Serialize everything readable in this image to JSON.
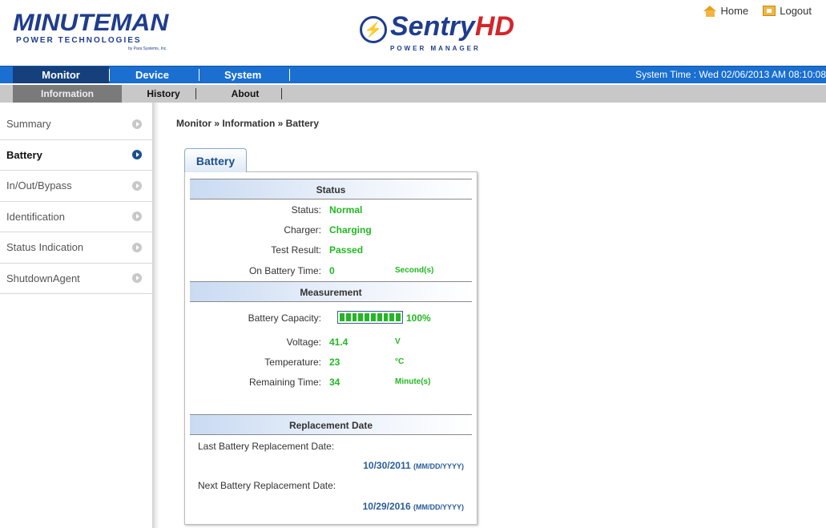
{
  "brand": {
    "name": "MINUTEMAN",
    "subtitle": "POWER TECHNOLOGIES",
    "fine": "by Para Systems, Inc.",
    "product": "Sentry",
    "product_suffix": "HD",
    "product_sub": "POWER MANAGER"
  },
  "toplinks": {
    "home": "Home",
    "logout": "Logout"
  },
  "mainnav": {
    "tabs": [
      "Monitor",
      "Device",
      "System"
    ],
    "system_time": "System Time : Wed 02/06/2013 AM 08:10:08"
  },
  "subnav": {
    "tabs": [
      "Information",
      "History",
      "About"
    ]
  },
  "sidebar": {
    "items": [
      "Summary",
      "Battery",
      "In/Out/Bypass",
      "Identification",
      "Status Indication",
      "ShutdownAgent"
    ]
  },
  "breadcrumb": "Monitor » Information » Battery",
  "panel": {
    "tab": "Battery",
    "status": {
      "heading": "Status",
      "status_label": "Status:",
      "status_value": "Normal",
      "charger_label": "Charger:",
      "charger_value": "Charging",
      "test_label": "Test Result:",
      "test_value": "Passed",
      "onbatt_label": "On Battery Time:",
      "onbatt_value": "0",
      "onbatt_unit": "Second(s)"
    },
    "measurement": {
      "heading": "Measurement",
      "capacity_label": "Battery Capacity:",
      "capacity_value": "100%",
      "capacity_fraction": 1.0,
      "voltage_label": "Voltage:",
      "voltage_value": "41.4",
      "voltage_unit": "V",
      "temp_label": "Temperature:",
      "temp_value": "23",
      "temp_unit": "°C",
      "remain_label": "Remaining Time:",
      "remain_value": "34",
      "remain_unit": "Minute(s)"
    },
    "replacement": {
      "heading": "Replacement Date",
      "last_label": "Last Battery Replacement Date:",
      "last_value": "10/30/2011",
      "last_format": "(MM/DD/YYYY)",
      "next_label": "Next Battery Replacement Date:",
      "next_value": "10/29/2016",
      "next_format": "(MM/DD/YYYY)"
    }
  },
  "colors": {
    "nav_blue": "#1a6fd0",
    "nav_active": "#15407c",
    "value_green": "#22b822",
    "date_blue": "#2a5d9a"
  }
}
